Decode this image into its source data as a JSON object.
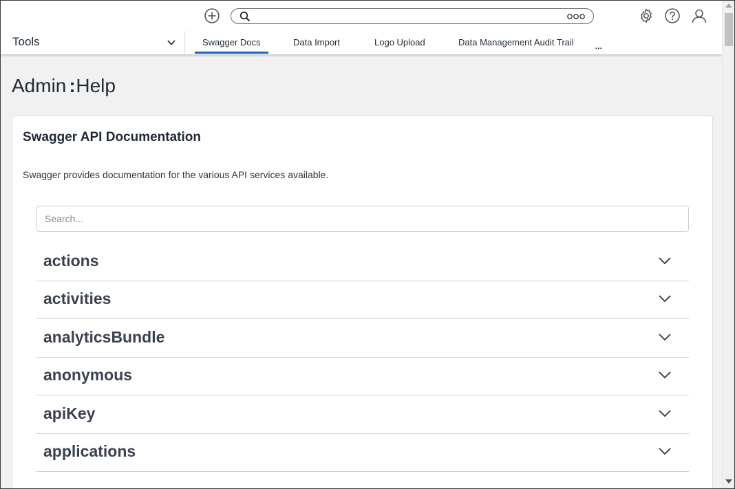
{
  "topbar": {
    "search_placeholder": ""
  },
  "nav": {
    "section_label": "Tools",
    "tabs": [
      {
        "label": "Swagger Docs",
        "active": true
      },
      {
        "label": "Data Import",
        "active": false
      },
      {
        "label": "Logo Upload",
        "active": false
      },
      {
        "label": "Data Management Audit Trail",
        "active": false
      }
    ],
    "more_label": "..."
  },
  "page": {
    "title_left": "Admin",
    "title_sep": ":",
    "title_right": "Help"
  },
  "card": {
    "title": "Swagger API Documentation",
    "description": "Swagger provides documentation for the various API services available.",
    "search_placeholder": "Search..."
  },
  "api_groups": [
    {
      "name": "actions"
    },
    {
      "name": "activities"
    },
    {
      "name": "analyticsBundle"
    },
    {
      "name": "anonymous"
    },
    {
      "name": "apiKey"
    },
    {
      "name": "applications"
    }
  ],
  "colors": {
    "accent": "#1a66b3",
    "text_dark": "#1f2a36",
    "api_text": "#3b4151"
  },
  "icons": {
    "add": "add-circle-icon",
    "search": "search-icon",
    "more": "more-dots-icon",
    "settings": "gear-icon",
    "help": "help-icon",
    "user": "user-icon",
    "expand": "chevron-down-icon"
  }
}
